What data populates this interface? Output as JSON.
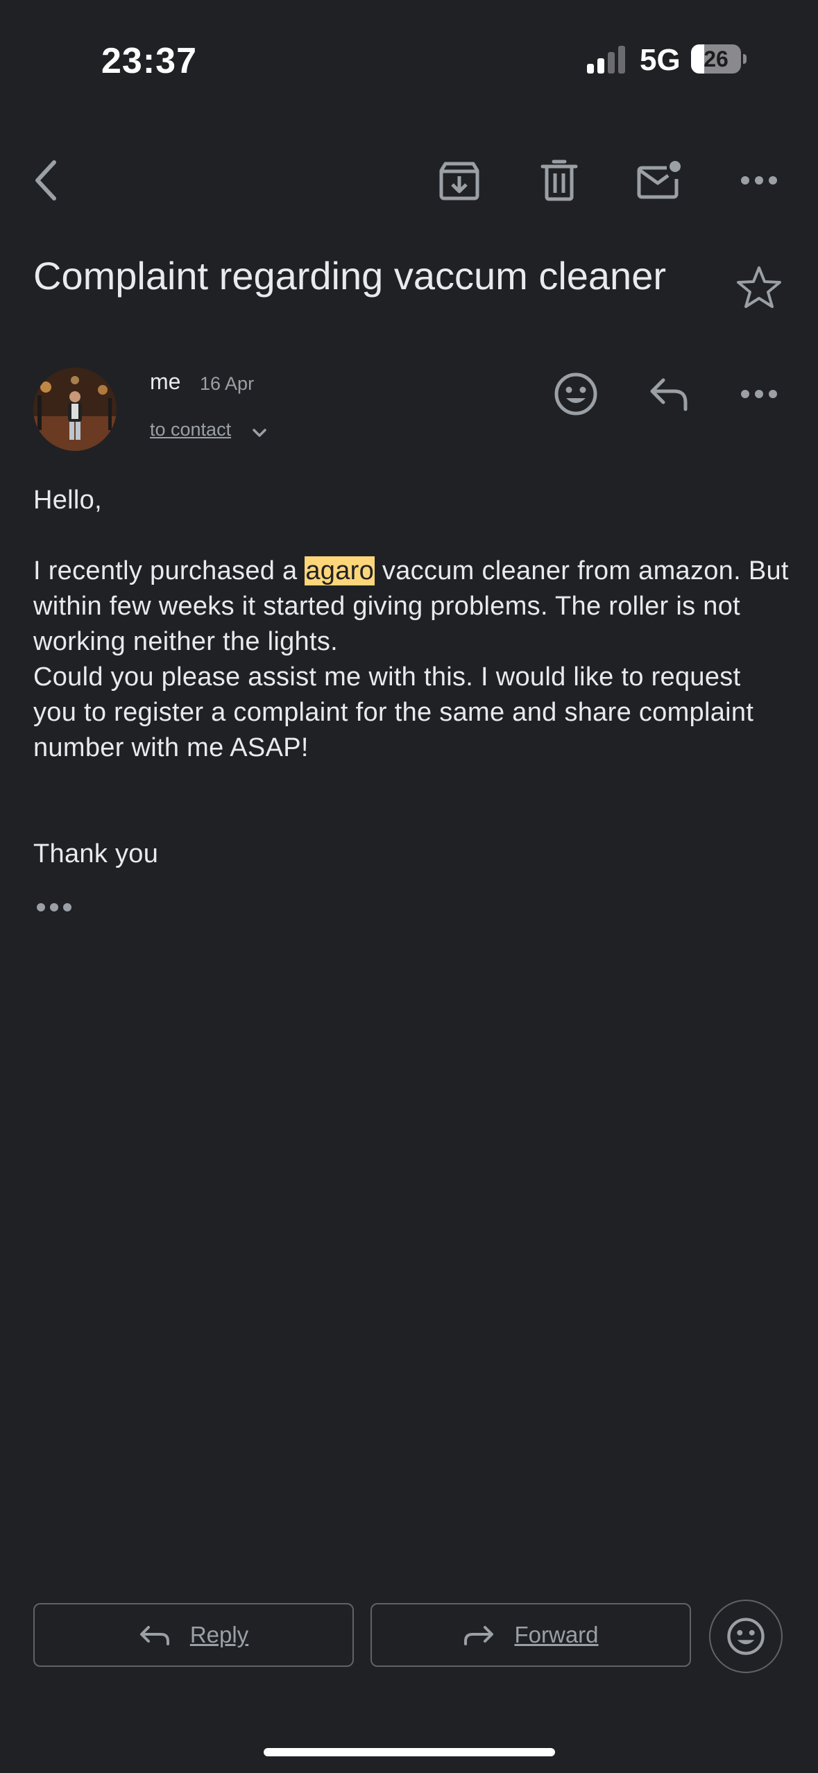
{
  "status_bar": {
    "time": "23:37",
    "network": "5G",
    "battery_level": "26",
    "battery_fraction": 0.26
  },
  "toolbar": {
    "icons": [
      "back-arrow-icon",
      "archive-icon",
      "trash-icon",
      "mark-unread-icon",
      "more-icon"
    ]
  },
  "email": {
    "subject": "Complaint regarding vaccum cleaner",
    "sender": "me",
    "date": "16 Apr",
    "recipient": "to contact",
    "body": {
      "greeting": "Hello,",
      "p1_before": "I recently purchased a ",
      "p1_highlight": "agaro",
      "p1_after": " vaccum cleaner from amazon. But within few weeks it started giving problems. The roller is not working neither the lights.",
      "p2": "Could you please assist me with this. I would like to request you to register a complaint for the same and share complaint  number with me ASAP!",
      "closing": "Thank you"
    }
  },
  "actions": {
    "reply_label": "Reply",
    "forward_label": "Forward"
  },
  "colors": {
    "background": "#202124",
    "text": "#e8eaed",
    "muted": "#9aa0a6",
    "icon": "#9aa0a6",
    "highlight": "#fdd67a"
  }
}
